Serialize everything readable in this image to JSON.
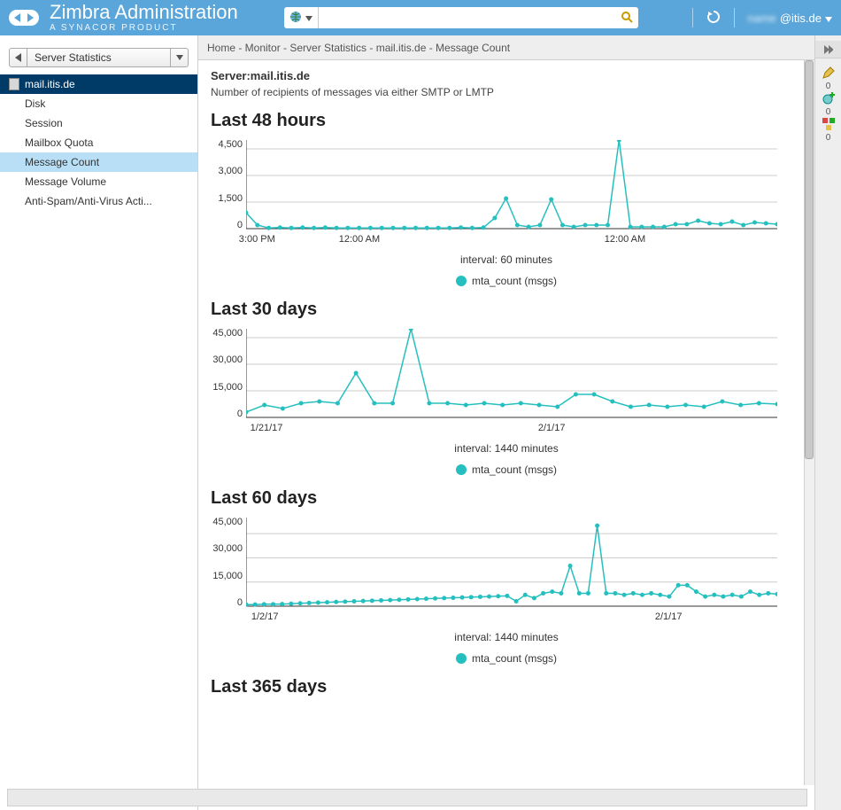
{
  "brand": {
    "title": "Zimbra Administration",
    "subtitle": "A SYNACOR PRODUCT"
  },
  "header": {
    "user": "@itis.de",
    "search_placeholder": ""
  },
  "sidebar": {
    "crumb_label": "Server Statistics",
    "root": "mail.itis.de",
    "items": [
      {
        "label": "Disk"
      },
      {
        "label": "Session"
      },
      {
        "label": "Mailbox Quota"
      },
      {
        "label": "Message Count",
        "selected": true
      },
      {
        "label": "Message Volume"
      },
      {
        "label": "Anti-Spam/Anti-Virus Acti..."
      }
    ]
  },
  "breadcrumb": "Home - Monitor - Server Statistics - mail.itis.de - Message Count",
  "page": {
    "server_label": "Server:mail.itis.de",
    "description": "Number of recipients of messages via either SMTP or LMTP",
    "legend_label": "mta_count (msgs)"
  },
  "right_tools": [
    {
      "icon": "pencil",
      "badge": "0"
    },
    {
      "icon": "cog-plus",
      "badge": "0"
    },
    {
      "icon": "blocks",
      "badge": "0"
    }
  ],
  "accent_color": "#26bfbf",
  "chart_data": [
    {
      "section_title": "Last 48 hours",
      "type": "line",
      "interval_label": "interval: 60 minutes",
      "ylim": [
        0,
        5000
      ],
      "yticks": [
        0,
        1500,
        3000,
        4500
      ],
      "xticks": [
        {
          "pos": 0.0,
          "label": "3:00 PM"
        },
        {
          "pos": 0.19,
          "label": "12:00 AM"
        },
        {
          "pos": 0.69,
          "label": "12:00 AM"
        }
      ],
      "values": [
        900,
        200,
        40,
        60,
        40,
        60,
        40,
        60,
        40,
        40,
        40,
        40,
        40,
        40,
        40,
        40,
        40,
        40,
        40,
        60,
        40,
        60,
        600,
        1700,
        200,
        100,
        200,
        1650,
        200,
        100,
        200,
        200,
        200,
        5200,
        100,
        100,
        100,
        100,
        250,
        250,
        450,
        300,
        250,
        400,
        200,
        350,
        300,
        250
      ]
    },
    {
      "section_title": "Last 30 days",
      "type": "line",
      "interval_label": "interval: 1440 minutes",
      "ylim": [
        0,
        50000
      ],
      "yticks": [
        0,
        15000,
        30000,
        45000
      ],
      "xticks": [
        {
          "pos": 0.02,
          "label": "1/21/17"
        },
        {
          "pos": 0.56,
          "label": "2/1/17"
        }
      ],
      "values": [
        3000,
        7000,
        5000,
        8000,
        9000,
        8000,
        25000,
        8000,
        8000,
        50000,
        8000,
        8000,
        7000,
        8000,
        7000,
        8000,
        7000,
        6000,
        13000,
        13000,
        9000,
        6000,
        7000,
        6000,
        7000,
        6000,
        9000,
        7000,
        8000,
        7500
      ]
    },
    {
      "section_title": "Last 60 days",
      "type": "line",
      "interval_label": "interval: 1440 minutes",
      "ylim": [
        0,
        55000
      ],
      "yticks": [
        0,
        15000,
        30000,
        45000
      ],
      "xticks": [
        {
          "pos": 0.02,
          "label": "1/2/17"
        },
        {
          "pos": 0.78,
          "label": "2/1/17"
        }
      ],
      "values": [
        1000,
        1000,
        1200,
        1200,
        1300,
        1500,
        1800,
        2000,
        2200,
        2400,
        2600,
        2800,
        3000,
        3200,
        3400,
        3600,
        3800,
        4000,
        4200,
        4400,
        4600,
        4800,
        5000,
        5200,
        5400,
        5600,
        5800,
        6000,
        6200,
        6400,
        3000,
        7000,
        5000,
        8000,
        9000,
        8000,
        25000,
        8000,
        8000,
        50000,
        8000,
        8000,
        7000,
        8000,
        7000,
        8000,
        7000,
        6000,
        13000,
        13000,
        9000,
        6000,
        7000,
        6000,
        7000,
        6000,
        9000,
        7000,
        8000,
        7500
      ]
    },
    {
      "section_title": "Last 365 days",
      "type": "line",
      "interval_label": "",
      "ylim": [
        0,
        1
      ],
      "yticks": [],
      "xticks": [],
      "values": []
    }
  ]
}
